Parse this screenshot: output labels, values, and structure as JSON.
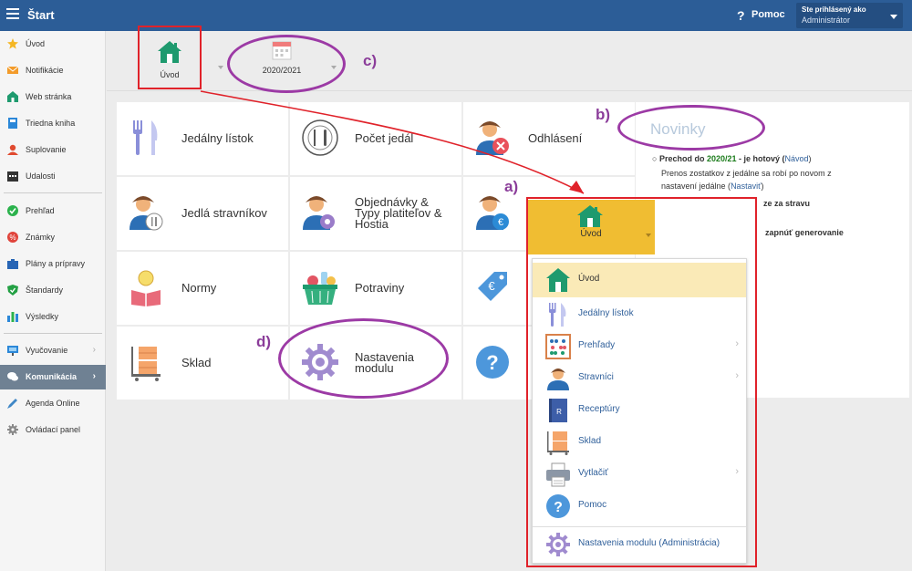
{
  "header": {
    "title": "Štart",
    "help_label": "Pomoc",
    "logged_as": "Ste prihlásený ako",
    "user": "Administrátor",
    "colors": {
      "bar": "#2c5d97"
    }
  },
  "sidebar": {
    "items": [
      {
        "label": "Úvod",
        "icon": "star-icon"
      },
      {
        "label": "Notifikácie",
        "icon": "envelope-icon"
      },
      {
        "label": "Web stránka",
        "icon": "house-icon"
      },
      {
        "label": "Triedna kniha",
        "icon": "book-icon"
      },
      {
        "label": "Suplovanie",
        "icon": "person-icon"
      },
      {
        "label": "Udalosti",
        "icon": "calendar-icon"
      },
      {
        "label": "Prehľad",
        "icon": "check-icon"
      },
      {
        "label": "Známky",
        "icon": "grades-icon"
      },
      {
        "label": "Plány a prípravy",
        "icon": "briefcase-icon"
      },
      {
        "label": "Štandardy",
        "icon": "shield-icon"
      },
      {
        "label": "Výsledky",
        "icon": "barchart-icon"
      },
      {
        "label": "Vyučovanie",
        "icon": "board-icon"
      },
      {
        "label": "Komunikácia",
        "icon": "chat-icon"
      },
      {
        "label": "Agenda Online",
        "icon": "pen-icon"
      },
      {
        "label": "Ovládací panel",
        "icon": "gear-icon"
      }
    ]
  },
  "toolbar": {
    "home_label": "Úvod",
    "year_label": "2020/2021"
  },
  "tiles": [
    {
      "label": "Jedálny lístok"
    },
    {
      "label": "Počet jedál"
    },
    {
      "label": "Odhlásení"
    },
    {
      "label": "Jedlá stravníkov"
    },
    {
      "label1": "Objednávky &",
      "label2": "Typy platiteľov &",
      "label3": "Hostia"
    },
    {
      "label": "Normy"
    },
    {
      "label": "Potraviny"
    },
    {
      "label": "Sklad"
    },
    {
      "label1": "Nastavenia",
      "label2": "modulu"
    }
  ],
  "news": {
    "heading": "Novinky",
    "l1a": "Prechod do ",
    "l1b": "2020/21",
    "l1c": " - je hotový (",
    "l1d": "Návod",
    "l1e": ")",
    "l2": "Prenos zostatkov z jedálne sa robí po novom z",
    "l3a": "nastavení jedálne (",
    "l3b": "Nastaviť",
    "l3c": ")",
    "l4": "ze za stravu",
    "l5": "zapnúť generovanie"
  },
  "dropdown": {
    "head_label": "Úvod",
    "items": [
      {
        "label": "Úvod",
        "icon": "house-icon"
      },
      {
        "label": "Jedálny lístok",
        "icon": "cutlery-icon"
      },
      {
        "label": "Prehľady",
        "icon": "abacus-icon"
      },
      {
        "label": "Stravníci",
        "icon": "person-icon"
      },
      {
        "label": "Receptúry",
        "icon": "recipe-book-icon"
      },
      {
        "label": "Sklad",
        "icon": "boxes-cart-icon"
      },
      {
        "label": "Vytlačiť",
        "icon": "printer-icon"
      },
      {
        "label": "Pomoc",
        "icon": "question-icon"
      },
      {
        "label": "Nastavenia modulu (Administrácia)",
        "icon": "gear-icon"
      }
    ]
  },
  "annotations": {
    "a": "a)",
    "b": "b)",
    "c": "c)",
    "d": "d)"
  }
}
